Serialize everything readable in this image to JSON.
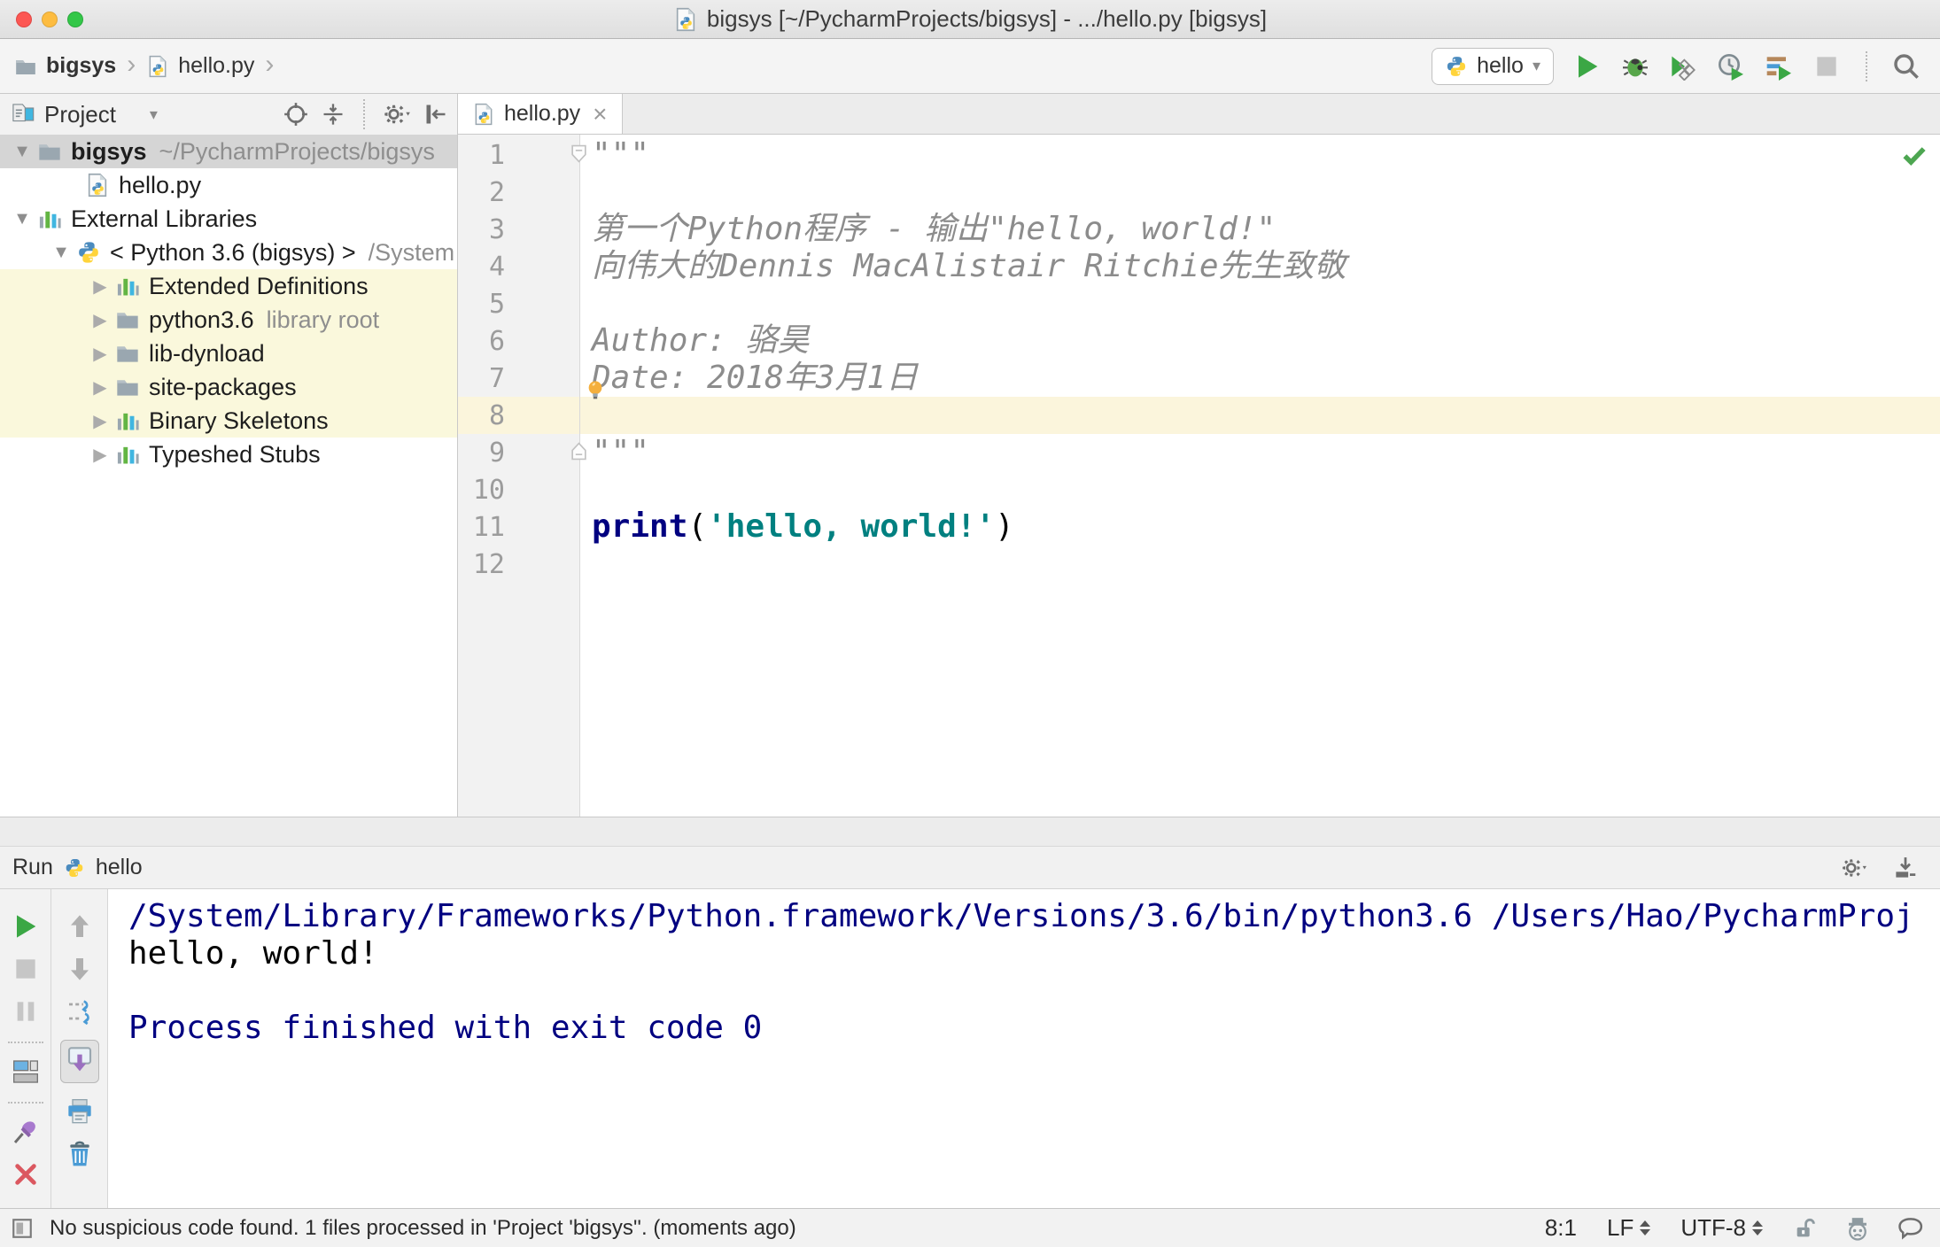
{
  "colors": {
    "keyword": "#000080",
    "string": "#008080",
    "docstring": "#8C8C8C",
    "console_system": "#000080",
    "console_stdout": "#000000",
    "caret_row": "#FBF5DC",
    "tree_highlight": "#FAF8DC",
    "tree_selection": "#D5D5D5"
  },
  "titlebar": {
    "title": "bigsys [~/PycharmProjects/bigsys] - .../hello.py [bigsys]"
  },
  "navbar": {
    "breadcrumbs": [
      {
        "label": "bigsys"
      },
      {
        "label": "hello.py"
      }
    ],
    "run_config": "hello",
    "actions": [
      {
        "icon": "run-icon"
      },
      {
        "icon": "debug-icon"
      },
      {
        "icon": "run-with-coverage-icon"
      },
      {
        "icon": "profiler-icon"
      },
      {
        "icon": "concurrency-diagram-icon"
      },
      {
        "icon": "stop-icon",
        "disabled": true
      },
      {
        "sep": true
      },
      {
        "icon": "search-everywhere-icon"
      }
    ]
  },
  "project_panel": {
    "header": {
      "title": "Project"
    },
    "header_actions": [
      {
        "icon": "locate-icon"
      },
      {
        "icon": "collapse-all-icon"
      },
      {
        "sep": true
      },
      {
        "icon": "settings-gear-icon"
      },
      {
        "icon": "hide-panel-icon"
      }
    ],
    "tree": [
      {
        "arrow": "open",
        "icon": "folder-icon",
        "label": "bigsys",
        "bold": true,
        "sublabel": "~/PycharmProjects/bigsys",
        "indent": 0,
        "selected": true
      },
      {
        "arrow": "none",
        "icon": "python-file-icon",
        "label": "hello.py",
        "indent": 2
      },
      {
        "arrow": "open",
        "icon": "library-icon",
        "label": "External Libraries",
        "indent": 0
      },
      {
        "arrow": "open",
        "icon": "python-icon",
        "label": "< Python 3.6 (bigsys) >",
        "sublabel": "/System",
        "indent": 1
      },
      {
        "arrow": "closed",
        "icon": "library-icon",
        "label": "Extended Definitions",
        "indent": 2,
        "highlight": true
      },
      {
        "arrow": "closed",
        "icon": "folder-icon",
        "label": "python3.6",
        "sublabel": "library root",
        "indent": 2,
        "highlight": true
      },
      {
        "arrow": "closed",
        "icon": "folder-icon",
        "label": "lib-dynload",
        "indent": 2,
        "highlight": true
      },
      {
        "arrow": "closed",
        "icon": "folder-icon",
        "label": "site-packages",
        "indent": 2,
        "highlight": true
      },
      {
        "arrow": "closed",
        "icon": "library-icon",
        "label": "Binary Skeletons",
        "indent": 2,
        "highlight": true
      },
      {
        "arrow": "closed",
        "icon": "library-icon",
        "label": "Typeshed Stubs",
        "indent": 2
      }
    ]
  },
  "editor": {
    "tab": {
      "label": "hello.py",
      "close": "×"
    },
    "lines": [
      {
        "n": "1",
        "parts": [
          {
            "t": "\"\"\"",
            "s": "doc"
          }
        ],
        "fold": "open"
      },
      {
        "n": "2",
        "parts": []
      },
      {
        "n": "3",
        "parts": [
          {
            "t": "第一个Python程序 - 输出\"hello, world!\"",
            "s": "doc"
          }
        ]
      },
      {
        "n": "4",
        "parts": [
          {
            "t": "向伟大的Dennis MacAlistair Ritchie先生致敬",
            "s": "doc"
          }
        ]
      },
      {
        "n": "5",
        "parts": []
      },
      {
        "n": "6",
        "parts": [
          {
            "t": "Author: 骆昊",
            "s": "doc"
          }
        ]
      },
      {
        "n": "7",
        "parts": [
          {
            "t": "Date: 2018年3月1日",
            "s": "doc"
          }
        ],
        "bulb": true
      },
      {
        "n": "8",
        "parts": [],
        "caret": true
      },
      {
        "n": "9",
        "parts": [
          {
            "t": "\"\"\"",
            "s": "doc"
          }
        ],
        "fold": "close"
      },
      {
        "n": "10",
        "parts": []
      },
      {
        "n": "11",
        "parts": [
          {
            "t": "print",
            "s": "kw"
          },
          {
            "t": "(",
            "s": "plain"
          },
          {
            "t": "'hello, world!'",
            "s": "str"
          },
          {
            "t": ")",
            "s": "plain"
          }
        ]
      },
      {
        "n": "12",
        "parts": []
      }
    ]
  },
  "run_panel": {
    "label": "Run",
    "config_name": "hello",
    "header_actions": [
      {
        "icon": "settings-gear-icon"
      },
      {
        "icon": "dock-icon"
      }
    ],
    "left_toolbar": [
      {
        "icon": "rerun-icon"
      },
      {
        "icon": "stop-icon",
        "disabled": true
      },
      {
        "icon": "pause-output-icon",
        "disabled": true
      },
      {
        "sep": true
      },
      {
        "icon": "restore-layout-icon"
      },
      {
        "sep": true
      },
      {
        "icon": "pin-tab-icon"
      },
      {
        "icon": "close-icon"
      },
      {
        "icon": "more-icon"
      }
    ],
    "console_toolbar": [
      {
        "icon": "up-stack-trace-icon"
      },
      {
        "icon": "down-stack-trace-icon"
      },
      {
        "icon": "soft-wrap-icon"
      },
      {
        "icon": "scroll-to-end-icon",
        "selected": true
      },
      {
        "icon": "print-icon"
      },
      {
        "icon": "clear-all-icon"
      }
    ],
    "console": [
      {
        "t": "/System/Library/Frameworks/Python.framework/Versions/3.6/bin/python3.6 /Users/Hao/PycharmProj",
        "s": "sys"
      },
      {
        "t": "hello, world!",
        "s": "out"
      },
      {
        "t": "",
        "s": "out"
      },
      {
        "t": "Process finished with exit code 0",
        "s": "sys"
      }
    ]
  },
  "status_bar": {
    "message": "No suspicious code found. 1 files processed in 'Project 'bigsys''. (moments ago)",
    "position": "8:1",
    "line_separator": "LF",
    "encoding": "UTF-8",
    "right_icons": [
      {
        "icon": "lock-icon"
      },
      {
        "icon": "hector-icon"
      },
      {
        "icon": "feedback-bubble-icon"
      }
    ]
  }
}
